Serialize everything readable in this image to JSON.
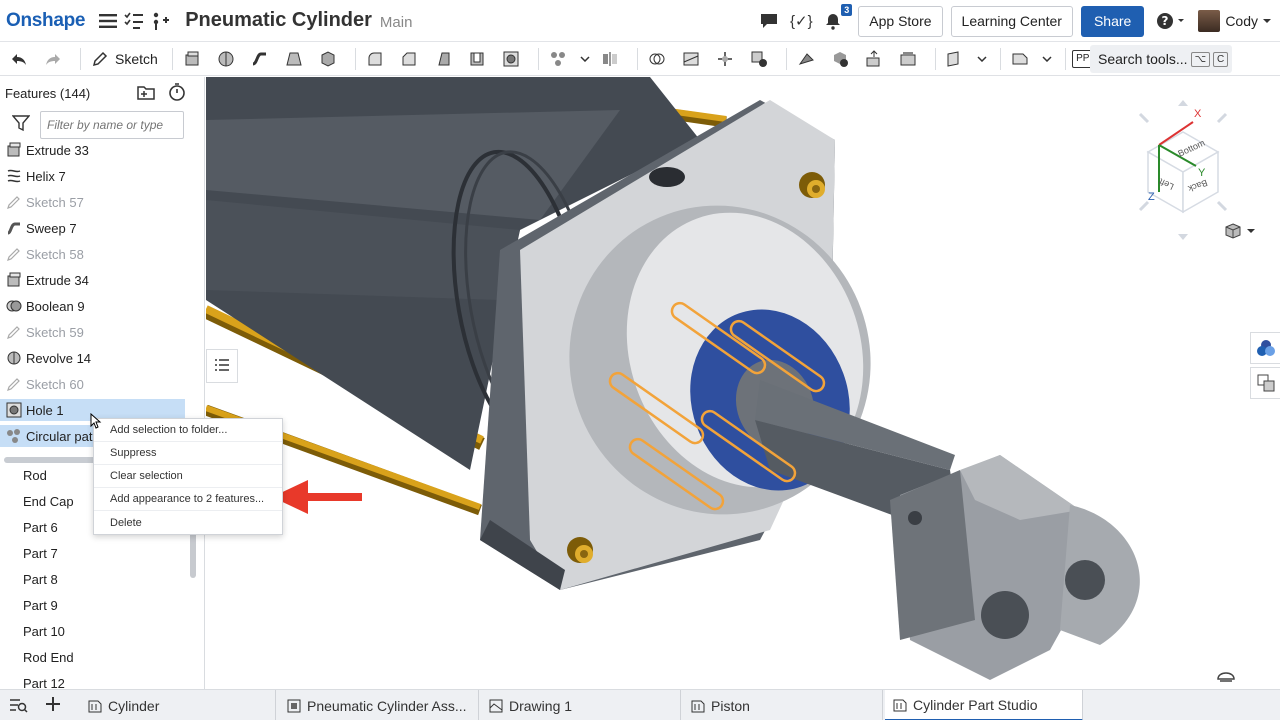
{
  "app": {
    "logo": "Onshape",
    "document_title": "Pneumatic Cylinder",
    "branch": "Main",
    "notifications_count": "3",
    "app_store_label": "App Store",
    "learning_center_label": "Learning Center",
    "share_label": "Share",
    "user_name": "Cody",
    "code_icon_text": "{✓}"
  },
  "toolbar": {
    "sketch_label": "Sketch",
    "search_tools_label": "Search tools...",
    "shortcut_keys": [
      "⌥",
      "C"
    ],
    "pp_label": "PP"
  },
  "panel": {
    "features_header": "Features (144)",
    "filter_placeholder": "Filter by name or type",
    "features": [
      {
        "label": "Extrude 33",
        "icon": "extrude-icon",
        "dim": false
      },
      {
        "label": "Helix 7",
        "icon": "helix-icon",
        "dim": false
      },
      {
        "label": "Sketch 57",
        "icon": "sketch-icon",
        "dim": true
      },
      {
        "label": "Sweep 7",
        "icon": "sweep-icon",
        "dim": false
      },
      {
        "label": "Sketch 58",
        "icon": "sketch-icon",
        "dim": true
      },
      {
        "label": "Extrude 34",
        "icon": "extrude-icon",
        "dim": false
      },
      {
        "label": "Boolean 9",
        "icon": "boolean-icon",
        "dim": false
      },
      {
        "label": "Sketch 59",
        "icon": "sketch-icon",
        "dim": true
      },
      {
        "label": "Revolve 14",
        "icon": "revolve-icon",
        "dim": false
      },
      {
        "label": "Sketch 60",
        "icon": "sketch-icon",
        "dim": true
      },
      {
        "label": "Hole 1",
        "icon": "hole-icon",
        "dim": false
      },
      {
        "label": "Circular pat",
        "icon": "circular-pattern-icon",
        "dim": false
      }
    ],
    "parts": [
      "Rod",
      "End Cap",
      "Part 6",
      "Part 7",
      "Part 8",
      "Part 9",
      "Part 10",
      "Rod End",
      "Part 12"
    ]
  },
  "context_menu": {
    "selection_count": "2",
    "items": [
      "Add selection to folder...",
      "Suppress",
      "Clear selection",
      "Add appearance to 2 features...",
      "Delete"
    ]
  },
  "view_cube": {
    "top_face": "Bottom",
    "left_face": "Left",
    "right_face": "Back",
    "axis_x": "X",
    "axis_y": "Y",
    "axis_z": "Z"
  },
  "tabs": [
    {
      "label": "Cylinder",
      "active": false
    },
    {
      "label": "Pneumatic Cylinder Ass...",
      "active": false
    },
    {
      "label": "Drawing 1",
      "active": false
    },
    {
      "label": "Piston",
      "active": false
    },
    {
      "label": "Cylinder Part Studio",
      "active": true
    }
  ],
  "colors": {
    "brand_blue": "#1f5fb1",
    "selection_blue": "#c6def6",
    "highlight_orange": "#f2a33a",
    "rod_gold": "#d9a21b",
    "arrow_red": "#e8392a",
    "wiper_blue": "#2f4f9f"
  }
}
